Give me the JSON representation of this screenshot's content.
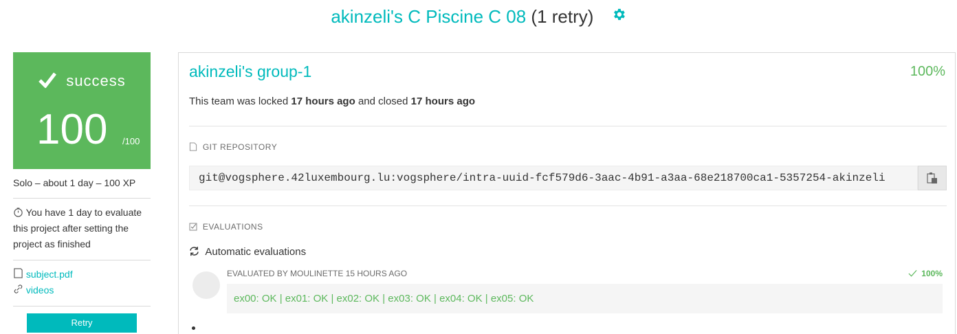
{
  "header": {
    "project_title": "akinzeli's C Piscine C 08",
    "retry_text": "(1 retry)",
    "settings_icon": "gear-icon",
    "accent_color": "#00babc"
  },
  "score": {
    "status_icon": "check-icon",
    "status": "success",
    "value": "100",
    "max": "/100",
    "color": "#5cb85c"
  },
  "sidebar": {
    "meta": "Solo – about 1 day – 100 XP",
    "evaluate_notice": "You have 1 day to evaluate this project after setting the project as finished",
    "attachments": [
      {
        "icon": "file-icon",
        "label": "subject.pdf"
      },
      {
        "icon": "link-icon",
        "label": "videos"
      }
    ],
    "retry_button": "Retry"
  },
  "team": {
    "name": "akinzeli's group-1",
    "percent": "100%",
    "lock_prefix": "This team was locked",
    "locked_ago": "17 hours ago",
    "lock_middle": "and closed",
    "closed_ago": "17 hours ago"
  },
  "git": {
    "section_label": "GIT REPOSITORY",
    "repo_url": "git@vogsphere.42luxembourg.lu:vogsphere/intra-uuid-fcf579d6-3aac-4b91-a3aa-68e218700ca1-5357254-akinzeli",
    "copy_icon": "clipboard-icon"
  },
  "evaluations": {
    "section_label": "EVALUATIONS",
    "auto_label": "Automatic evaluations",
    "evaluated_by": "EVALUATED BY MOULINETTE 15 HOURS AGO",
    "percent": "100%",
    "result": "ex00: OK | ex01: OK | ex02: OK | ex03: OK | ex04: OK | ex05: OK"
  }
}
